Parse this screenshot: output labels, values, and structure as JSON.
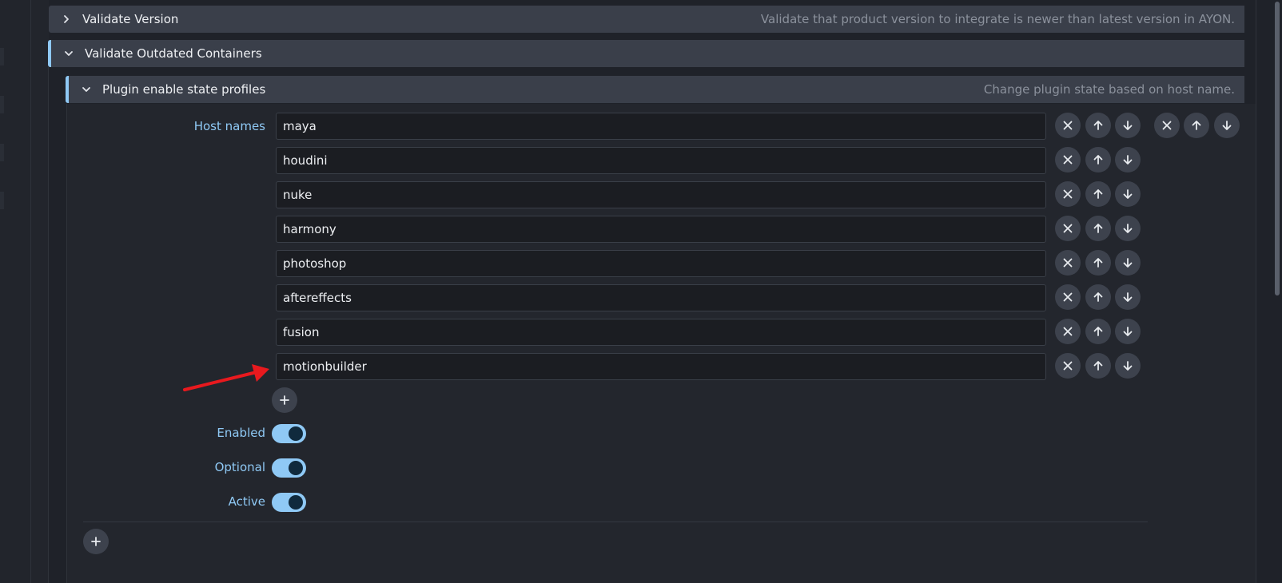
{
  "sections": {
    "validate_version": {
      "title": "Validate Version",
      "description": "Validate that product version to integrate is newer than latest version in AYON.",
      "expanded": false
    },
    "validate_outdated": {
      "title": "Validate Outdated Containers",
      "expanded": true
    },
    "plugin_profiles": {
      "title": "Plugin enable state profiles",
      "description": "Change plugin state based on host name.",
      "expanded": true
    }
  },
  "host_names": {
    "label": "Host names",
    "items": [
      "maya",
      "houdini",
      "nuke",
      "harmony",
      "photoshop",
      "aftereffects",
      "fusion",
      "motionbuilder"
    ]
  },
  "toggles": [
    {
      "label": "Enabled",
      "on": true
    },
    {
      "label": "Optional",
      "on": true
    },
    {
      "label": "Active",
      "on": true
    }
  ],
  "icons": {
    "remove": "close-icon",
    "up": "arrow-up-icon",
    "down": "arrow-down-icon",
    "add": "plus-icon",
    "collapsed": "chevron-right-icon",
    "expanded": "chevron-down-icon",
    "annotation": "red-arrow-annotation"
  },
  "colors": {
    "accent": "#8fc9f5",
    "header_bg": "#3a3f4a",
    "annotation": "#e8191e"
  }
}
